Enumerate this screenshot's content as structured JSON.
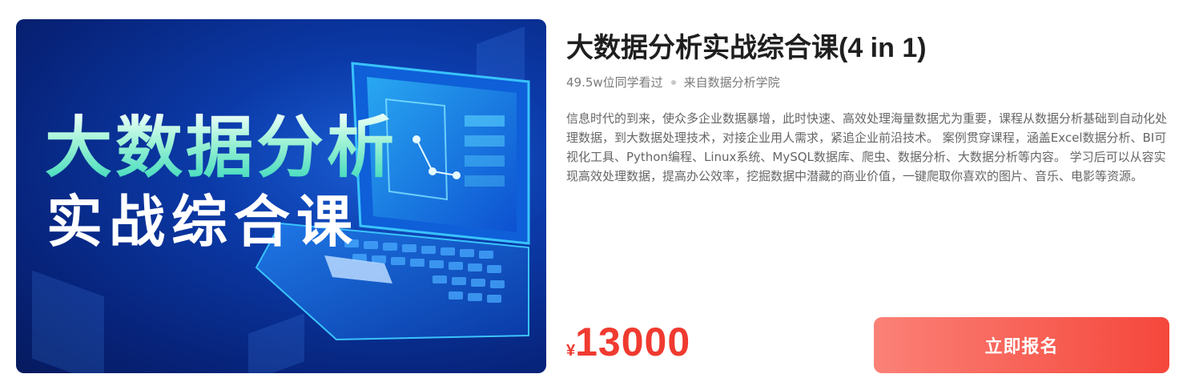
{
  "course": {
    "banner_line1": "大数据分析",
    "banner_line2": "实战综合课",
    "title": "大数据分析实战综合课(4 in 1)",
    "viewers": "49.5w位同学看过",
    "source": "来自数据分析学院",
    "description": "信息时代的到来，使众多企业数据暴增，此时快速、高效处理海量数据尤为重要，课程从数据分析基础到自动化处理数据，到大数据处理技术，对接企业用人需求，紧追企业前沿技术。 案例贯穿课程，涵盖Excel数据分析、BI可视化工具、Python编程、Linux系统、MySQL数据库、爬虫、数据分析、大数据分析等内容。 学习后可以从容实现高效处理数据，提高办公效率，挖掘数据中潜藏的商业价值，一键爬取你喜欢的图片、音乐、电影等资源。",
    "currency": "¥",
    "price": "13000",
    "enroll_label": "立即报名"
  },
  "colors": {
    "price": "#f03a30",
    "button_start": "#fb8177",
    "button_end": "#f5473c"
  }
}
